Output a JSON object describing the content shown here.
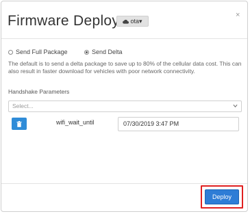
{
  "modal": {
    "title": "Firmware Deploy",
    "ota_label": "ota▾",
    "close_glyph": "×"
  },
  "options": {
    "full_package_label": "Send Full Package",
    "delta_label": "Send Delta",
    "selected": "delta"
  },
  "description": "The default is to send a delta package to save up to 80% of the cellular data cost. This can also result in faster download for vehicles with poor network connectivity.",
  "handshake": {
    "label": "Handshake Parameters",
    "select_placeholder": "Select...",
    "params": [
      {
        "key": "wifi_wait_until",
        "value": "07/30/2019 3:47 PM"
      }
    ]
  },
  "footer": {
    "deploy_label": "Deploy"
  },
  "colors": {
    "primary": "#2e7dd6",
    "highlight": "#e02020"
  }
}
